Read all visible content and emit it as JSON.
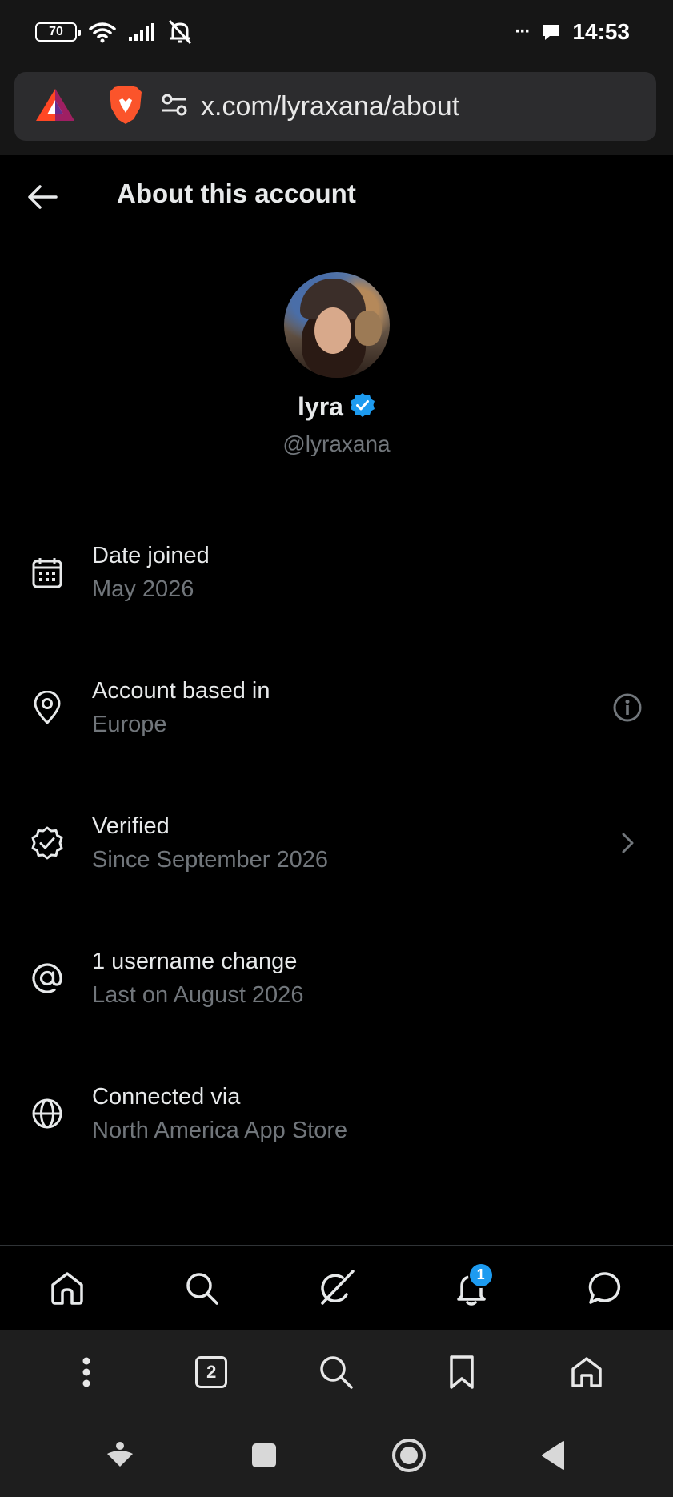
{
  "status_bar": {
    "battery": "70",
    "time": "14:53",
    "more": "···"
  },
  "browser": {
    "url": "x.com/lyraxana/about",
    "tabs_count": "2"
  },
  "header": {
    "title": "About this account",
    "back_icon": "arrow-left-icon"
  },
  "profile": {
    "display_name": "lyra",
    "handle": "@lyraxana",
    "verified": true,
    "verified_color": "#1d9bf0"
  },
  "info": [
    {
      "icon": "calendar-icon",
      "label": "Date joined",
      "value": "May 2026"
    },
    {
      "icon": "location-pin-icon",
      "label": "Account based in",
      "value": "Europe",
      "action": "info-icon"
    },
    {
      "icon": "verified-badge-icon",
      "label": "Verified",
      "value": "Since September 2026",
      "action": "chevron-right-icon"
    },
    {
      "icon": "at-sign-icon",
      "label": "1 username change",
      "value": "Last on August 2026"
    },
    {
      "icon": "globe-icon",
      "label": "Connected via",
      "value": "North America App Store"
    }
  ],
  "x_nav": {
    "items": [
      "home-icon",
      "search-icon",
      "grok-icon",
      "notifications-icon",
      "messages-icon"
    ],
    "notifications_badge": "1"
  },
  "colors": {
    "background": "#000000",
    "primary_text": "#e7e9ea",
    "secondary_text": "#71767b",
    "accent": "#1d9bf0"
  }
}
